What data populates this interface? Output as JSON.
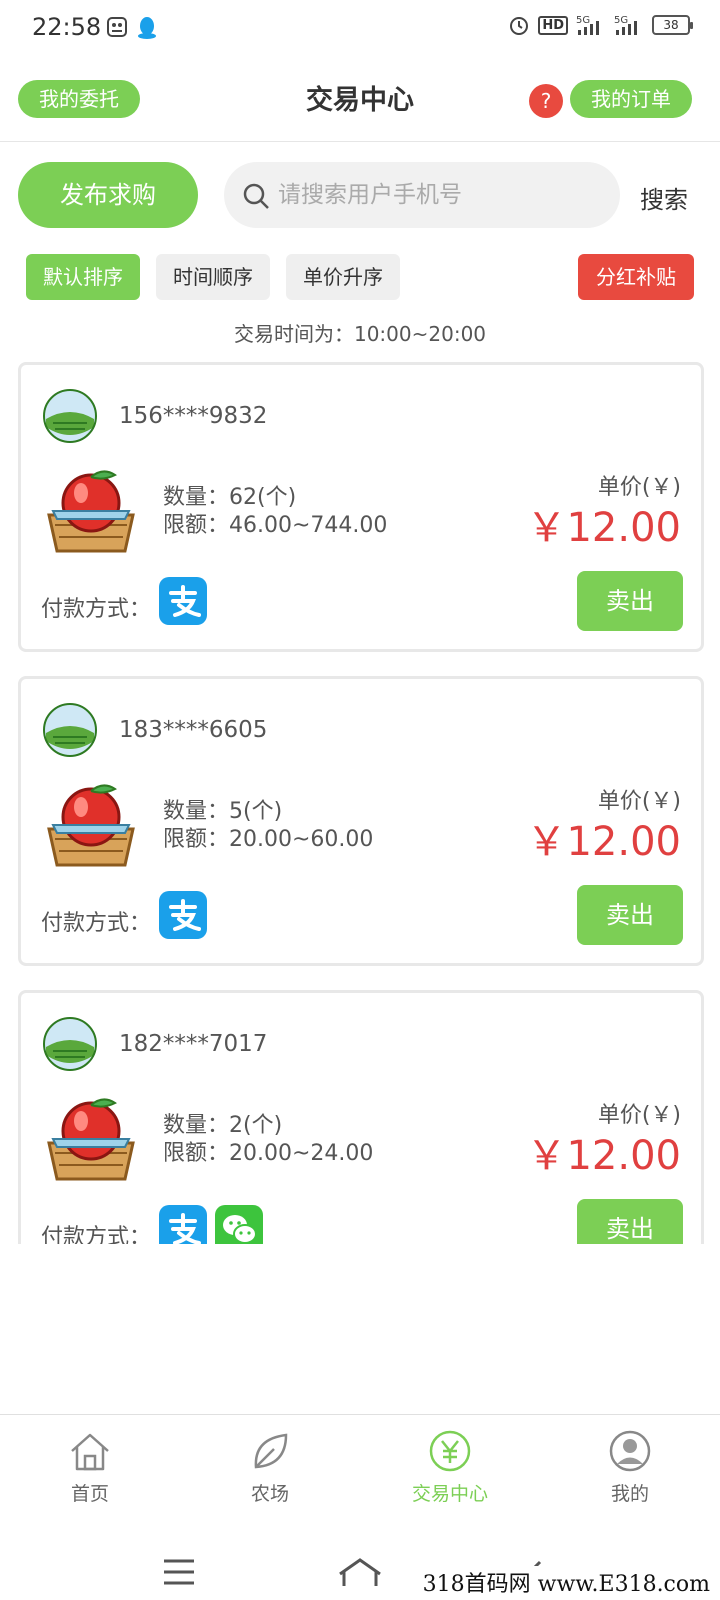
{
  "status_bar": {
    "time": "22:58",
    "battery": "38",
    "network": "5G"
  },
  "header": {
    "left_button": "我的委托",
    "title": "交易中心",
    "help_label": "?",
    "right_button": "我的订单"
  },
  "search": {
    "publish_label": "发布求购",
    "placeholder": "请搜索用户手机号",
    "button_label": "搜索"
  },
  "sort_tabs": [
    {
      "label": "默认排序",
      "active": true
    },
    {
      "label": "时间顺序",
      "active": false
    },
    {
      "label": "单价升序",
      "active": false
    }
  ],
  "bonus_button": "分红补贴",
  "trade_time": "交易时间为：10:00~20:00",
  "listings": [
    {
      "phone": "156****9832",
      "qty": "数量：62(个)",
      "limit": "限额：46.00~744.00",
      "unit_label": "单价(￥)",
      "price": "￥12.00",
      "pay_label": "付款方式：",
      "pay_methods": [
        "alipay-icon"
      ],
      "sell_label": "卖出"
    },
    {
      "phone": "183****6605",
      "qty": "数量：5(个)",
      "limit": "限额：20.00~60.00",
      "unit_label": "单价(￥)",
      "price": "￥12.00",
      "pay_label": "付款方式：",
      "pay_methods": [
        "alipay-icon"
      ],
      "sell_label": "卖出"
    },
    {
      "phone": "182****7017",
      "qty": "数量：2(个)",
      "limit": "限额：20.00~24.00",
      "unit_label": "单价(￥)",
      "price": "￥12.00",
      "pay_label": "付款方式：",
      "pay_methods": [
        "alipay-icon",
        "wechat-icon"
      ],
      "sell_label": "卖出"
    }
  ],
  "bottom_nav": [
    {
      "label": "首页",
      "icon": "home-icon",
      "active": false
    },
    {
      "label": "农场",
      "icon": "leaf-icon",
      "active": false
    },
    {
      "label": "交易中心",
      "icon": "yuan-icon",
      "active": true
    },
    {
      "label": "我的",
      "icon": "profile-icon",
      "active": false
    }
  ],
  "watermark": "318首码网 www.E318.com",
  "colors": {
    "accent": "#7ccf55",
    "price": "#e04040",
    "danger": "#e84a3f",
    "alipay": "#1aa0ea",
    "wechat": "#3dc43d"
  }
}
